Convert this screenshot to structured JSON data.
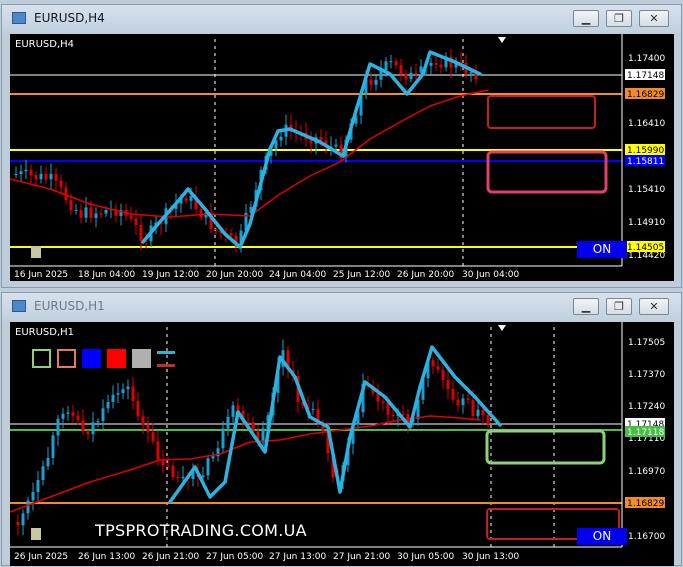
{
  "windows": [
    {
      "title": "EURUSD,H4",
      "chart_label": "EURUSD,H4",
      "y_ticks": [
        "1.17400",
        "1.16410",
        "1.15410",
        "1.14910",
        "1.14420"
      ],
      "x_ticks": [
        "16 Jun 2025",
        "18 Jun 04:00",
        "19 Jun 12:00",
        "20 Jun 20:00",
        "24 Jun 04:00",
        "25 Jun 12:00",
        "26 Jun 20:00",
        "30 Jun 04:00"
      ],
      "price_tags": [
        {
          "text": "1.17148",
          "bg": "#ffffff",
          "fg": "#000000"
        },
        {
          "text": "1.16829",
          "bg": "#f28c28",
          "fg": "#000000"
        },
        {
          "text": "1.15990",
          "bg": "#ffff00",
          "fg": "#000000"
        },
        {
          "text": "1.15811",
          "bg": "#0000ff",
          "fg": "#ffffff"
        },
        {
          "text": "1.14505",
          "bg": "#ffff00",
          "fg": "#000000"
        }
      ],
      "on_button": "ON"
    },
    {
      "title": "EURUSD,H1",
      "chart_label": "EURUSD,H1",
      "y_ticks": [
        "1.17505",
        "1.17370",
        "1.17240",
        "1.17110",
        "1.16970",
        "1.16700"
      ],
      "x_ticks": [
        "26 Jun 2025",
        "26 Jun 13:00",
        "26 Jun 21:00",
        "27 Jun 05:00",
        "27 Jun 13:00",
        "27 Jun 21:00",
        "30 Jun 05:00",
        "30 Jun 13:00"
      ],
      "price_tags": [
        {
          "text": "1.17148",
          "bg": "#ffffff",
          "fg": "#000000"
        },
        {
          "text": "1.17118",
          "bg": "#44c044",
          "fg": "#ffffff"
        },
        {
          "text": "1.16829",
          "bg": "#f28c28",
          "fg": "#000000"
        }
      ],
      "watermark": "TPSPROTRADING.COM.UA",
      "on_button": "ON"
    }
  ],
  "colors": {
    "bull": "#1a9fd1",
    "bear": "#e00000",
    "ma": "#e00000",
    "zigzag": "#2ab2e0",
    "axis_text": "#ffffff"
  }
}
